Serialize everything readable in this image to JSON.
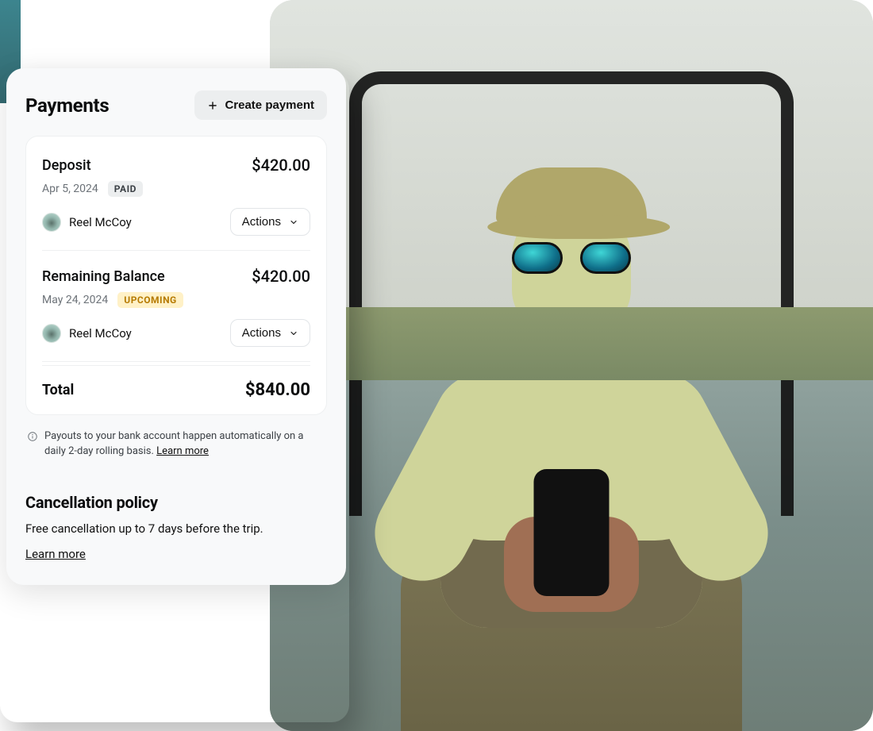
{
  "header": {
    "title": "Payments",
    "create_label": "Create payment"
  },
  "payments": [
    {
      "title": "Deposit",
      "amount": "$420.00",
      "date": "Apr 5, 2024",
      "status_label": "PAID",
      "status_kind": "paid",
      "party_name": "Reel McCoy",
      "actions_label": "Actions"
    },
    {
      "title": "Remaining Balance",
      "amount": "$420.00",
      "date": "May 24, 2024",
      "status_label": "UPCOMING",
      "status_kind": "upcoming",
      "party_name": "Reel McCoy",
      "actions_label": "Actions"
    }
  ],
  "total": {
    "label": "Total",
    "amount": "$840.00"
  },
  "payout_note": {
    "text": "Payouts to your bank account happen automatically on a daily 2-day rolling basis. ",
    "link_label": "Learn more"
  },
  "cancellation": {
    "heading": "Cancellation policy",
    "body": "Free cancellation up to 7 days before the trip.",
    "link_label": "Learn more"
  },
  "icons": {
    "plus": "plus-icon",
    "chevron_down": "chevron-down-icon",
    "info": "info-icon"
  }
}
